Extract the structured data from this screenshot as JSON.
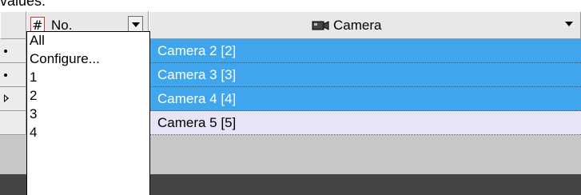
{
  "top_text": "values:",
  "header": {
    "number_column": {
      "icon": "hash-icon",
      "icon_glyph": "#",
      "label": "No."
    },
    "camera_column": {
      "icon": "camera-icon",
      "label": "Camera"
    }
  },
  "rows": [
    {
      "indicator": "dot",
      "camera": "Camera 2 [2]",
      "selected": true
    },
    {
      "indicator": "dot",
      "camera": "Camera 3 [3]",
      "selected": true
    },
    {
      "indicator": "arrow",
      "camera": "Camera 4 [4]",
      "selected": true
    },
    {
      "indicator": "none",
      "camera": "Camera 5 [5]",
      "selected": false
    }
  ],
  "filter_dropdown": {
    "items": [
      "All",
      "Configure...",
      "1",
      "2",
      "3",
      "4"
    ]
  },
  "colors": {
    "selected_row": "#3fa6ee",
    "plain_row": "#e8e4f7",
    "header": "#e8e8e8",
    "footer": "#444444"
  }
}
